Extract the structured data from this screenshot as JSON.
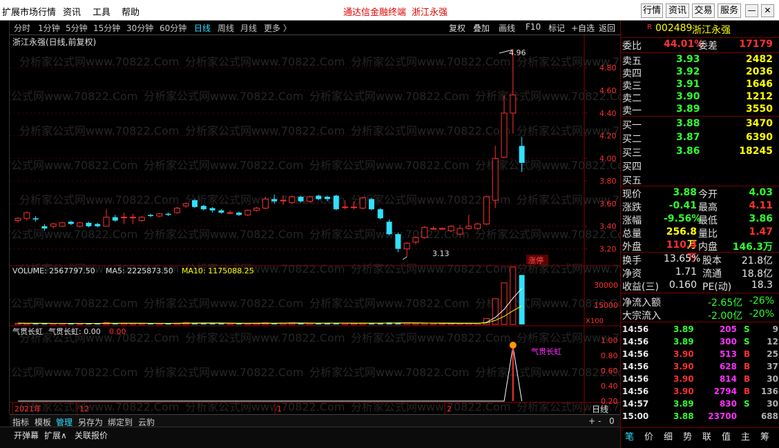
{
  "menubar": {
    "menus": [
      "扩展市场行情",
      "资讯",
      "工具",
      "帮助"
    ],
    "title_left": "通达信金融终端",
    "title_right": "浙江永强",
    "buttons": [
      "行情",
      "资讯",
      "交易",
      "服务"
    ]
  },
  "periods": {
    "items": [
      "分时",
      "1分钟",
      "5分钟",
      "15分钟",
      "30分钟",
      "60分钟",
      "日线",
      "周线",
      "月线",
      "更多 〉"
    ],
    "active": "日线",
    "tools": [
      "复权",
      "叠加",
      "画线",
      "F10",
      "标记",
      "+自选",
      "返回"
    ]
  },
  "chart": {
    "title": "浙江永强(日线,前复权)",
    "watermark": "分析家公式网www.70822.Com",
    "y_labels": [
      "4.80",
      "4.60",
      "4.40",
      "4.20",
      "4.00",
      "3.80",
      "3.60",
      "3.40",
      "3.20"
    ],
    "high_label": "4.96",
    "low_label": "3.13",
    "limit_tag": "涨停",
    "volume_header": {
      "vol": "VOLUME: 2567797.50",
      "ma5": "MA5: 2225873.50",
      "ma10": "MA10: 1175088.25"
    },
    "vol_labels": [
      "30000",
      "15000"
    ],
    "vol_unit": "X100",
    "ind_header": {
      "name": "气贯长虹",
      "value": "气贯长虹: 0.00",
      "value2": "0.00"
    },
    "ind_labels": [
      "1.00",
      "0.80",
      "0.60",
      "0.40",
      "0.20"
    ],
    "ind_tag": "气贯长虹",
    "date_labels": [
      "2021年",
      "12",
      "1",
      "2"
    ],
    "axis_tag": "日线"
  },
  "chart_data": {
    "type": "candlestick",
    "ylim": [
      3.1,
      5.0
    ],
    "candles": [
      [
        3.45,
        3.47,
        3.43,
        3.48
      ],
      [
        3.47,
        3.52,
        3.45,
        3.53
      ],
      [
        3.47,
        3.46,
        3.44,
        3.49
      ],
      [
        3.4,
        3.38,
        3.36,
        3.42
      ],
      [
        3.4,
        3.42,
        3.38,
        3.43
      ],
      [
        3.4,
        3.43,
        3.39,
        3.44
      ],
      [
        3.44,
        3.42,
        3.41,
        3.45
      ],
      [
        3.4,
        3.43,
        3.39,
        3.44
      ],
      [
        3.43,
        3.4,
        3.39,
        3.44
      ],
      [
        3.42,
        3.4,
        3.39,
        3.43
      ],
      [
        3.4,
        3.48,
        3.4,
        3.55
      ],
      [
        3.48,
        3.45,
        3.44,
        3.5
      ],
      [
        3.48,
        3.48,
        3.42,
        3.52
      ],
      [
        3.48,
        3.48,
        3.42,
        3.51
      ],
      [
        3.45,
        3.48,
        3.44,
        3.49
      ],
      [
        3.5,
        3.49,
        3.48,
        3.51
      ],
      [
        3.49,
        3.51,
        3.48,
        3.52
      ],
      [
        3.51,
        3.5,
        3.49,
        3.52
      ],
      [
        3.52,
        3.56,
        3.51,
        3.57
      ],
      [
        3.58,
        3.6,
        3.56,
        3.61
      ],
      [
        3.63,
        3.57,
        3.56,
        3.64
      ],
      [
        3.58,
        3.55,
        3.54,
        3.59
      ],
      [
        3.56,
        3.54,
        3.52,
        3.57
      ],
      [
        3.54,
        3.52,
        3.51,
        3.55
      ],
      [
        3.52,
        3.52,
        3.51,
        3.54
      ],
      [
        3.52,
        3.5,
        3.49,
        3.53
      ],
      [
        3.5,
        3.54,
        3.49,
        3.55
      ],
      [
        3.54,
        3.56,
        3.53,
        3.57
      ],
      [
        3.56,
        3.64,
        3.55,
        3.66
      ],
      [
        3.64,
        3.62,
        3.6,
        3.68
      ],
      [
        3.63,
        3.63,
        3.59,
        3.67
      ],
      [
        3.61,
        3.66,
        3.6,
        3.67
      ],
      [
        3.66,
        3.62,
        3.61,
        3.67
      ],
      [
        3.62,
        3.66,
        3.61,
        3.67
      ],
      [
        3.67,
        3.64,
        3.63,
        3.68
      ],
      [
        3.66,
        3.64,
        3.62,
        3.67
      ],
      [
        3.67,
        3.55,
        3.54,
        3.68
      ],
      [
        3.57,
        3.57,
        3.55,
        3.63
      ],
      [
        3.57,
        3.57,
        3.55,
        3.62
      ],
      [
        3.56,
        3.65,
        3.55,
        3.66
      ],
      [
        3.64,
        3.55,
        3.54,
        3.65
      ],
      [
        3.55,
        3.47,
        3.46,
        3.56
      ],
      [
        3.44,
        3.33,
        3.32,
        3.46
      ],
      [
        3.33,
        3.2,
        3.17,
        3.34
      ],
      [
        3.2,
        3.25,
        3.13,
        3.26
      ],
      [
        3.26,
        3.3,
        3.24,
        3.31
      ],
      [
        3.3,
        3.39,
        3.29,
        3.4
      ],
      [
        3.38,
        3.38,
        3.37,
        3.4
      ],
      [
        3.38,
        3.38,
        3.37,
        3.39
      ],
      [
        3.36,
        3.4,
        3.35,
        3.41
      ],
      [
        3.33,
        3.38,
        3.32,
        3.41
      ],
      [
        3.38,
        3.4,
        3.37,
        3.5
      ],
      [
        3.38,
        3.42,
        3.37,
        3.43
      ],
      [
        3.42,
        3.66,
        3.41,
        3.67
      ],
      [
        3.63,
        4.0,
        3.56,
        4.11
      ],
      [
        4.01,
        4.4,
        4.0,
        4.56
      ],
      [
        4.4,
        4.56,
        4.22,
        4.96
      ],
      [
        4.11,
        3.96,
        3.88,
        4.19
      ]
    ],
    "volume": [
      [
        0.06,
        0.05,
        0.06,
        0.05,
        0.05,
        0.05,
        0.05,
        0.05,
        0.05,
        0.05,
        0.09,
        0.05,
        0.06,
        0.05,
        0.05,
        0.05,
        0.05,
        0.05,
        0.06,
        0.09,
        0.09,
        0.07,
        0.06,
        0.05,
        0.05,
        0.05,
        0.05,
        0.06,
        0.08,
        0.07,
        0.07,
        0.08,
        0.06,
        0.06,
        0.06,
        0.06,
        0.08,
        0.06,
        0.05,
        0.06,
        0.07,
        0.08,
        0.1,
        0.09,
        0.07,
        0.06,
        0.06,
        0.05,
        0.05,
        0.05,
        0.05,
        0.06,
        0.06,
        0.3,
        1.3,
        2.1,
        2.9,
        2.5
      ]
    ],
    "ma5_line": true,
    "ma10_line": true,
    "indicator": {
      "name": "气贯长虹",
      "spike_at": 56
    }
  },
  "quote": {
    "flag": "R",
    "code": "002489",
    "name": "浙江永强",
    "weibi_label": "委比",
    "weibi": "44.01%",
    "weicha_label": "委差",
    "weicha": "17179",
    "asks": [
      {
        "label": "卖五",
        "price": "3.93",
        "vol": "2482"
      },
      {
        "label": "卖四",
        "price": "3.92",
        "vol": "2036"
      },
      {
        "label": "卖三",
        "price": "3.91",
        "vol": "1646"
      },
      {
        "label": "卖二",
        "price": "3.90",
        "vol": "1212"
      },
      {
        "label": "卖一",
        "price": "3.89",
        "vol": "3550"
      }
    ],
    "bids": [
      {
        "label": "买一",
        "price": "3.88",
        "vol": "3470"
      },
      {
        "label": "买二",
        "price": "3.87",
        "vol": "6390"
      },
      {
        "label": "买三",
        "price": "3.86",
        "vol": "18245"
      },
      {
        "label": "买四",
        "price": "",
        "vol": ""
      },
      {
        "label": "买五",
        "price": "",
        "vol": ""
      }
    ],
    "stats": [
      {
        "l1": "现价",
        "v1": "3.88",
        "l2": "今开",
        "v2": "4.03"
      },
      {
        "l1": "涨跌",
        "v1": "-0.41",
        "l2": "最高",
        "v2": "4.11"
      },
      {
        "l1": "涨幅",
        "v1": "-9.56%",
        "l2": "最低",
        "v2": "3.86"
      },
      {
        "l1": "总量",
        "v1": "256.8万",
        "l2": "量比",
        "v2": "1.47"
      },
      {
        "l1": "外盘",
        "v1": "110.4万",
        "l2": "内盘",
        "v2": "146.3万"
      }
    ],
    "stats2": [
      {
        "l1": "换手",
        "v1": "13.65%",
        "l2": "股本",
        "v2": "21.8亿"
      },
      {
        "l1": "净资",
        "v1": "1.71",
        "l2": "流通",
        "v2": "18.8亿"
      },
      {
        "l1": "收益(三)",
        "v1": "0.160",
        "l2": "PE(动)",
        "v2": "18.3"
      }
    ],
    "flows": [
      {
        "label": "净流入额",
        "v": "-2.65亿",
        "pct": "-26%"
      },
      {
        "label": "大宗流入",
        "v": "-2.00亿",
        "pct": "-20%"
      }
    ],
    "ticks": [
      {
        "t": "14:56",
        "p": "3.89",
        "v": "205",
        "s": "S",
        "n": "9"
      },
      {
        "t": "14:56",
        "p": "3.89",
        "v": "300",
        "s": "S",
        "n": "12"
      },
      {
        "t": "14:56",
        "p": "3.90",
        "v": "513",
        "s": "B",
        "n": "25"
      },
      {
        "t": "14:56",
        "p": "3.90",
        "v": "628",
        "s": "B",
        "n": "37"
      },
      {
        "t": "14:56",
        "p": "3.90",
        "v": "814",
        "s": "B",
        "n": "30"
      },
      {
        "t": "14:56",
        "p": "3.90",
        "v": "2794",
        "s": "B",
        "n": "136"
      },
      {
        "t": "14:57",
        "p": "3.89",
        "v": "830",
        "s": "S",
        "n": "30"
      },
      {
        "t": "15:00",
        "p": "3.88",
        "v": "23700",
        "s": "",
        "n": "688"
      }
    ],
    "tabs": [
      "笔",
      "价",
      "细",
      "势",
      "联",
      "值",
      "主",
      "筹"
    ]
  },
  "bottom": {
    "tabs1": [
      "指标",
      "模板",
      "管理",
      "另存为",
      "绑定到",
      "云豹"
    ],
    "tabs1_sel": "管理",
    "pager": [
      "+",
      "-",
      "0"
    ],
    "tabs2": [
      "开弹幕",
      "扩展∧",
      "关联报价"
    ]
  },
  "colors": {
    "up": "#ff3030",
    "down": "#30e0ff",
    "ma5": "#ffffff",
    "ma10": "#ffff00",
    "grid": "#8b0000"
  }
}
